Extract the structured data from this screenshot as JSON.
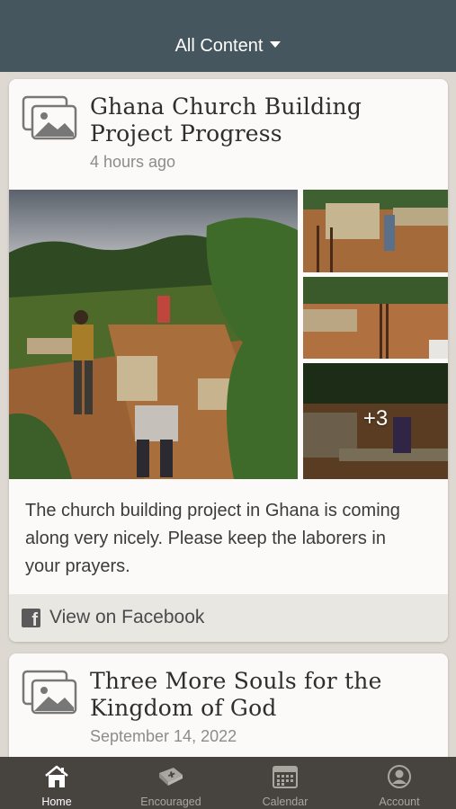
{
  "header": {
    "title": "All Content",
    "dropdown_icon": "caret-down-icon"
  },
  "posts": [
    {
      "icon": "photo-gallery-icon",
      "title": "Ghana Church Building Project Progress",
      "time": "4 hours ago",
      "extra_photos_label": "+3",
      "body": "The church building project in Ghana is coming along very nicely. Please keep the laborers in your prayers.",
      "action_icon": "facebook-icon",
      "action_label": "View on Facebook"
    },
    {
      "icon": "photo-gallery-icon",
      "title": "Three More Souls for the Kingdom of God",
      "time": "September 14, 2022"
    }
  ],
  "tabs": [
    {
      "label": "Home",
      "icon": "home-icon",
      "active": true
    },
    {
      "label": "Encouraged",
      "icon": "bible-icon",
      "active": false
    },
    {
      "label": "Calendar",
      "icon": "calendar-icon",
      "active": false
    },
    {
      "label": "Account",
      "icon": "account-icon",
      "active": false
    }
  ],
  "colors": {
    "header_bg": "#45565f",
    "tabbar_bg": "#474440",
    "page_bg": "#ddd9d2",
    "card_bg": "#fbfaf8"
  }
}
